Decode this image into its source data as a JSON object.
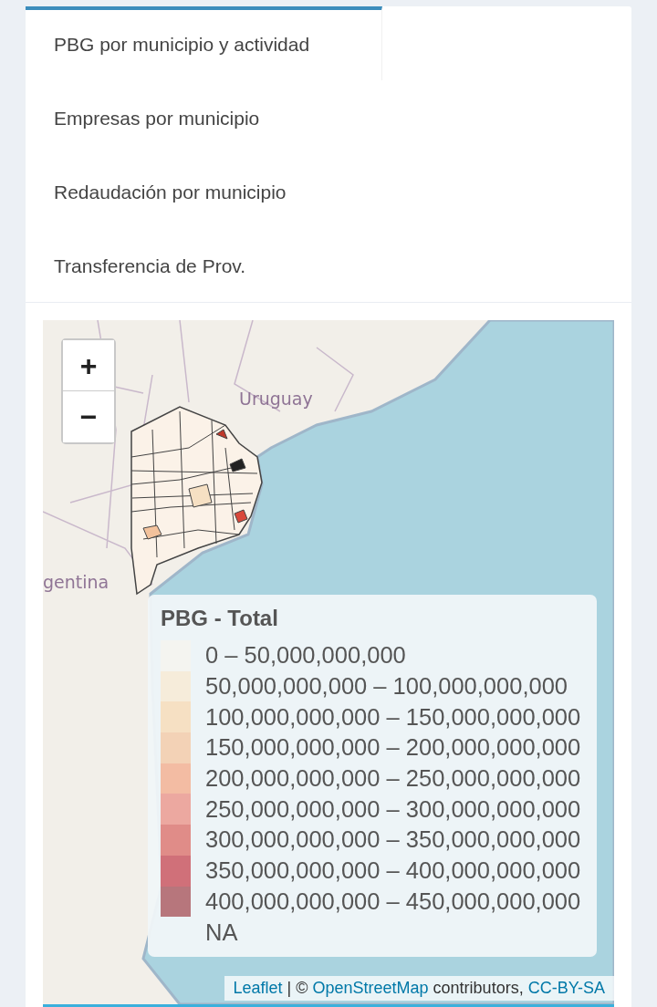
{
  "tabs": [
    {
      "label": "PBG por municipio y actividad",
      "selected": true
    },
    {
      "label": "Empresas por municipio",
      "selected": false
    },
    {
      "label": "Redaudación por municipio",
      "selected": false
    },
    {
      "label": "Transferencia de Prov.",
      "selected": false
    }
  ],
  "map": {
    "labels": [
      "Uruguay",
      "gentina"
    ],
    "zoom_controls": [
      "+",
      "−"
    ],
    "legend": {
      "title": "PBG - Total",
      "items": [
        {
          "label": "0 – 50,000,000,000",
          "color": "#f4f4f0"
        },
        {
          "label": "50,000,000,000 – 100,000,000,000",
          "color": "#f6ecda"
        },
        {
          "label": "100,000,000,000 – 150,000,000,000",
          "color": "#f6e0c3"
        },
        {
          "label": "150,000,000,000 – 200,000,000,000",
          "color": "#f3d2b6"
        },
        {
          "label": "200,000,000,000 – 250,000,000,000",
          "color": "#f3bca3"
        },
        {
          "label": "250,000,000,000 – 300,000,000,000",
          "color": "#eca8a0"
        },
        {
          "label": "300,000,000,000 – 350,000,000,000",
          "color": "#e08c88"
        },
        {
          "label": "350,000,000,000 – 400,000,000,000",
          "color": "#d07079"
        },
        {
          "label": "400,000,000,000 – 450,000,000,000",
          "color": "#b7767c"
        },
        {
          "label": "NA"
        }
      ]
    },
    "attribution": {
      "links": [
        "Leaflet",
        "OpenStreetMap",
        "CC-BY-SA"
      ],
      "texts": [
        " | © ",
        " contributors, "
      ]
    }
  }
}
